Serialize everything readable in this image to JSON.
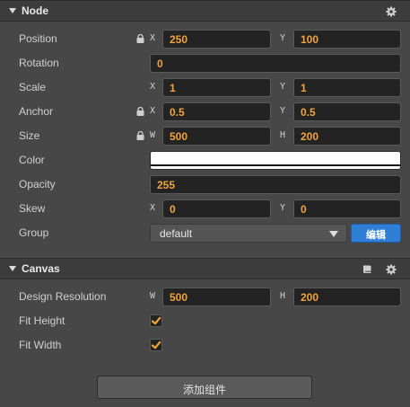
{
  "node": {
    "title": "Node",
    "position": {
      "label": "Position",
      "x_axis": "X",
      "x": "250",
      "y_axis": "Y",
      "y": "100"
    },
    "rotation": {
      "label": "Rotation",
      "value": "0"
    },
    "scale": {
      "label": "Scale",
      "x_axis": "X",
      "x": "1",
      "y_axis": "Y",
      "y": "1"
    },
    "anchor": {
      "label": "Anchor",
      "x_axis": "X",
      "x": "0.5",
      "y_axis": "Y",
      "y": "0.5"
    },
    "size": {
      "label": "Size",
      "w_axis": "W",
      "w": "500",
      "h_axis": "H",
      "h": "200"
    },
    "color": {
      "label": "Color",
      "value": "#ffffff"
    },
    "opacity": {
      "label": "Opacity",
      "value": "255"
    },
    "skew": {
      "label": "Skew",
      "x_axis": "X",
      "x": "0",
      "y_axis": "Y",
      "y": "0"
    },
    "group": {
      "label": "Group",
      "selected": "default",
      "edit_label": "编辑"
    }
  },
  "canvas": {
    "title": "Canvas",
    "design_resolution": {
      "label": "Design Resolution",
      "w_axis": "W",
      "w": "500",
      "h_axis": "H",
      "h": "200"
    },
    "fit_height": {
      "label": "Fit Height",
      "checked": true
    },
    "fit_width": {
      "label": "Fit Width",
      "checked": true
    }
  },
  "add_component_label": "添加组件",
  "colors": {
    "panel_bg": "#474747",
    "header_bg": "#3c3c3c",
    "field_bg": "#232323",
    "value_text": "#f2a33a",
    "accent_blue": "#2f7ed8",
    "check_orange": "#f2a33a"
  },
  "icons": [
    "collapse-triangle-icon",
    "gear-icon",
    "lock-icon",
    "book-icon",
    "checkmark-icon",
    "dropdown-caret-icon"
  ]
}
